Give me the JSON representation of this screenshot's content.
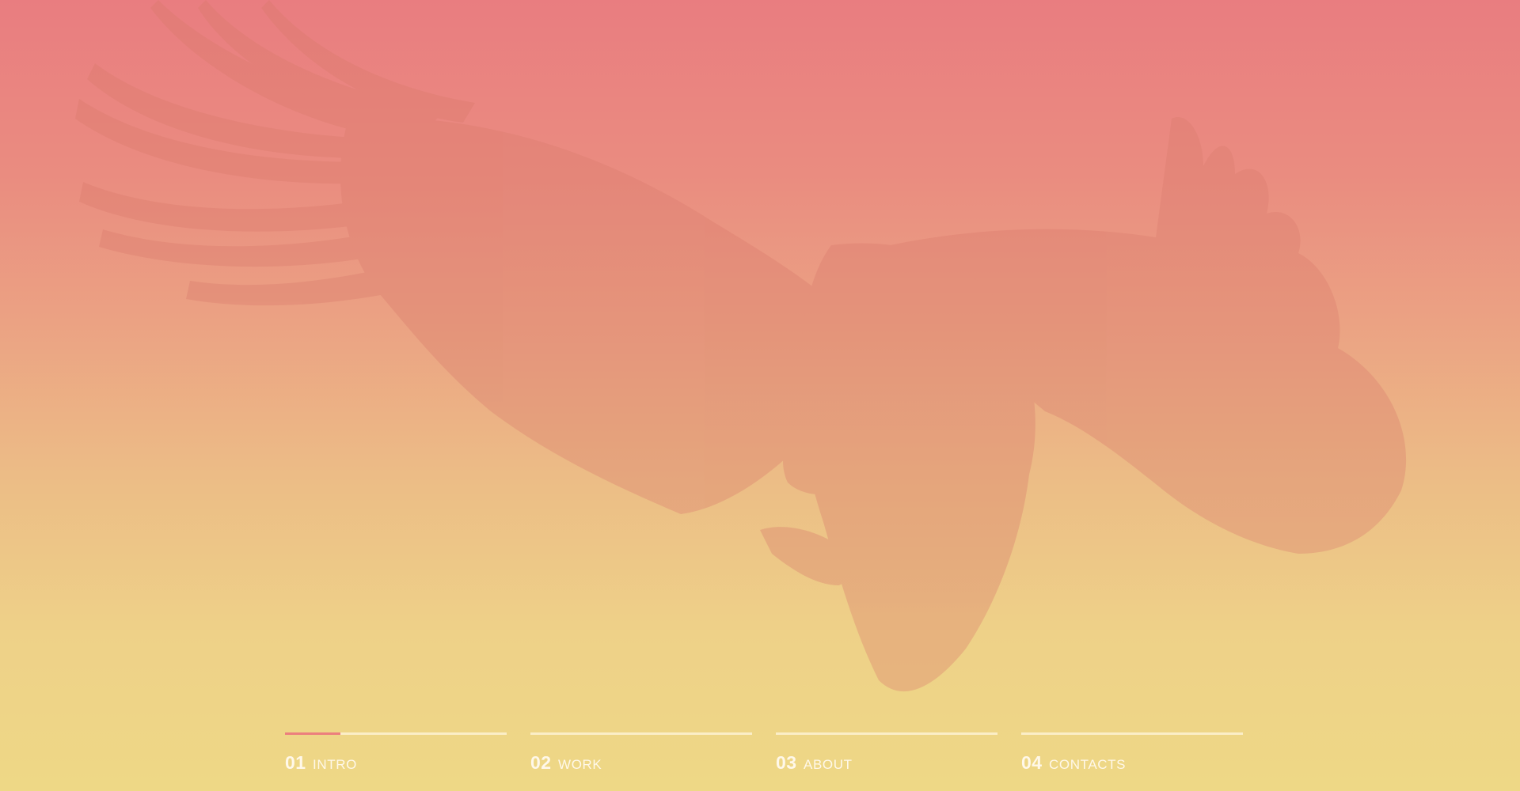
{
  "background": {
    "gradient_top": "#e97d80",
    "gradient_bottom": "#eed886",
    "image_subject": "eagle-icon"
  },
  "nav": {
    "accent": "#ec7f7d",
    "items": [
      {
        "number": "01",
        "label": "INTRO",
        "progress": 0.25,
        "active": true
      },
      {
        "number": "02",
        "label": "WORK",
        "progress": 0,
        "active": false
      },
      {
        "number": "03",
        "label": "ABOUT",
        "progress": 0,
        "active": false
      },
      {
        "number": "04",
        "label": "CONTACTS",
        "progress": 0,
        "active": false
      }
    ]
  }
}
